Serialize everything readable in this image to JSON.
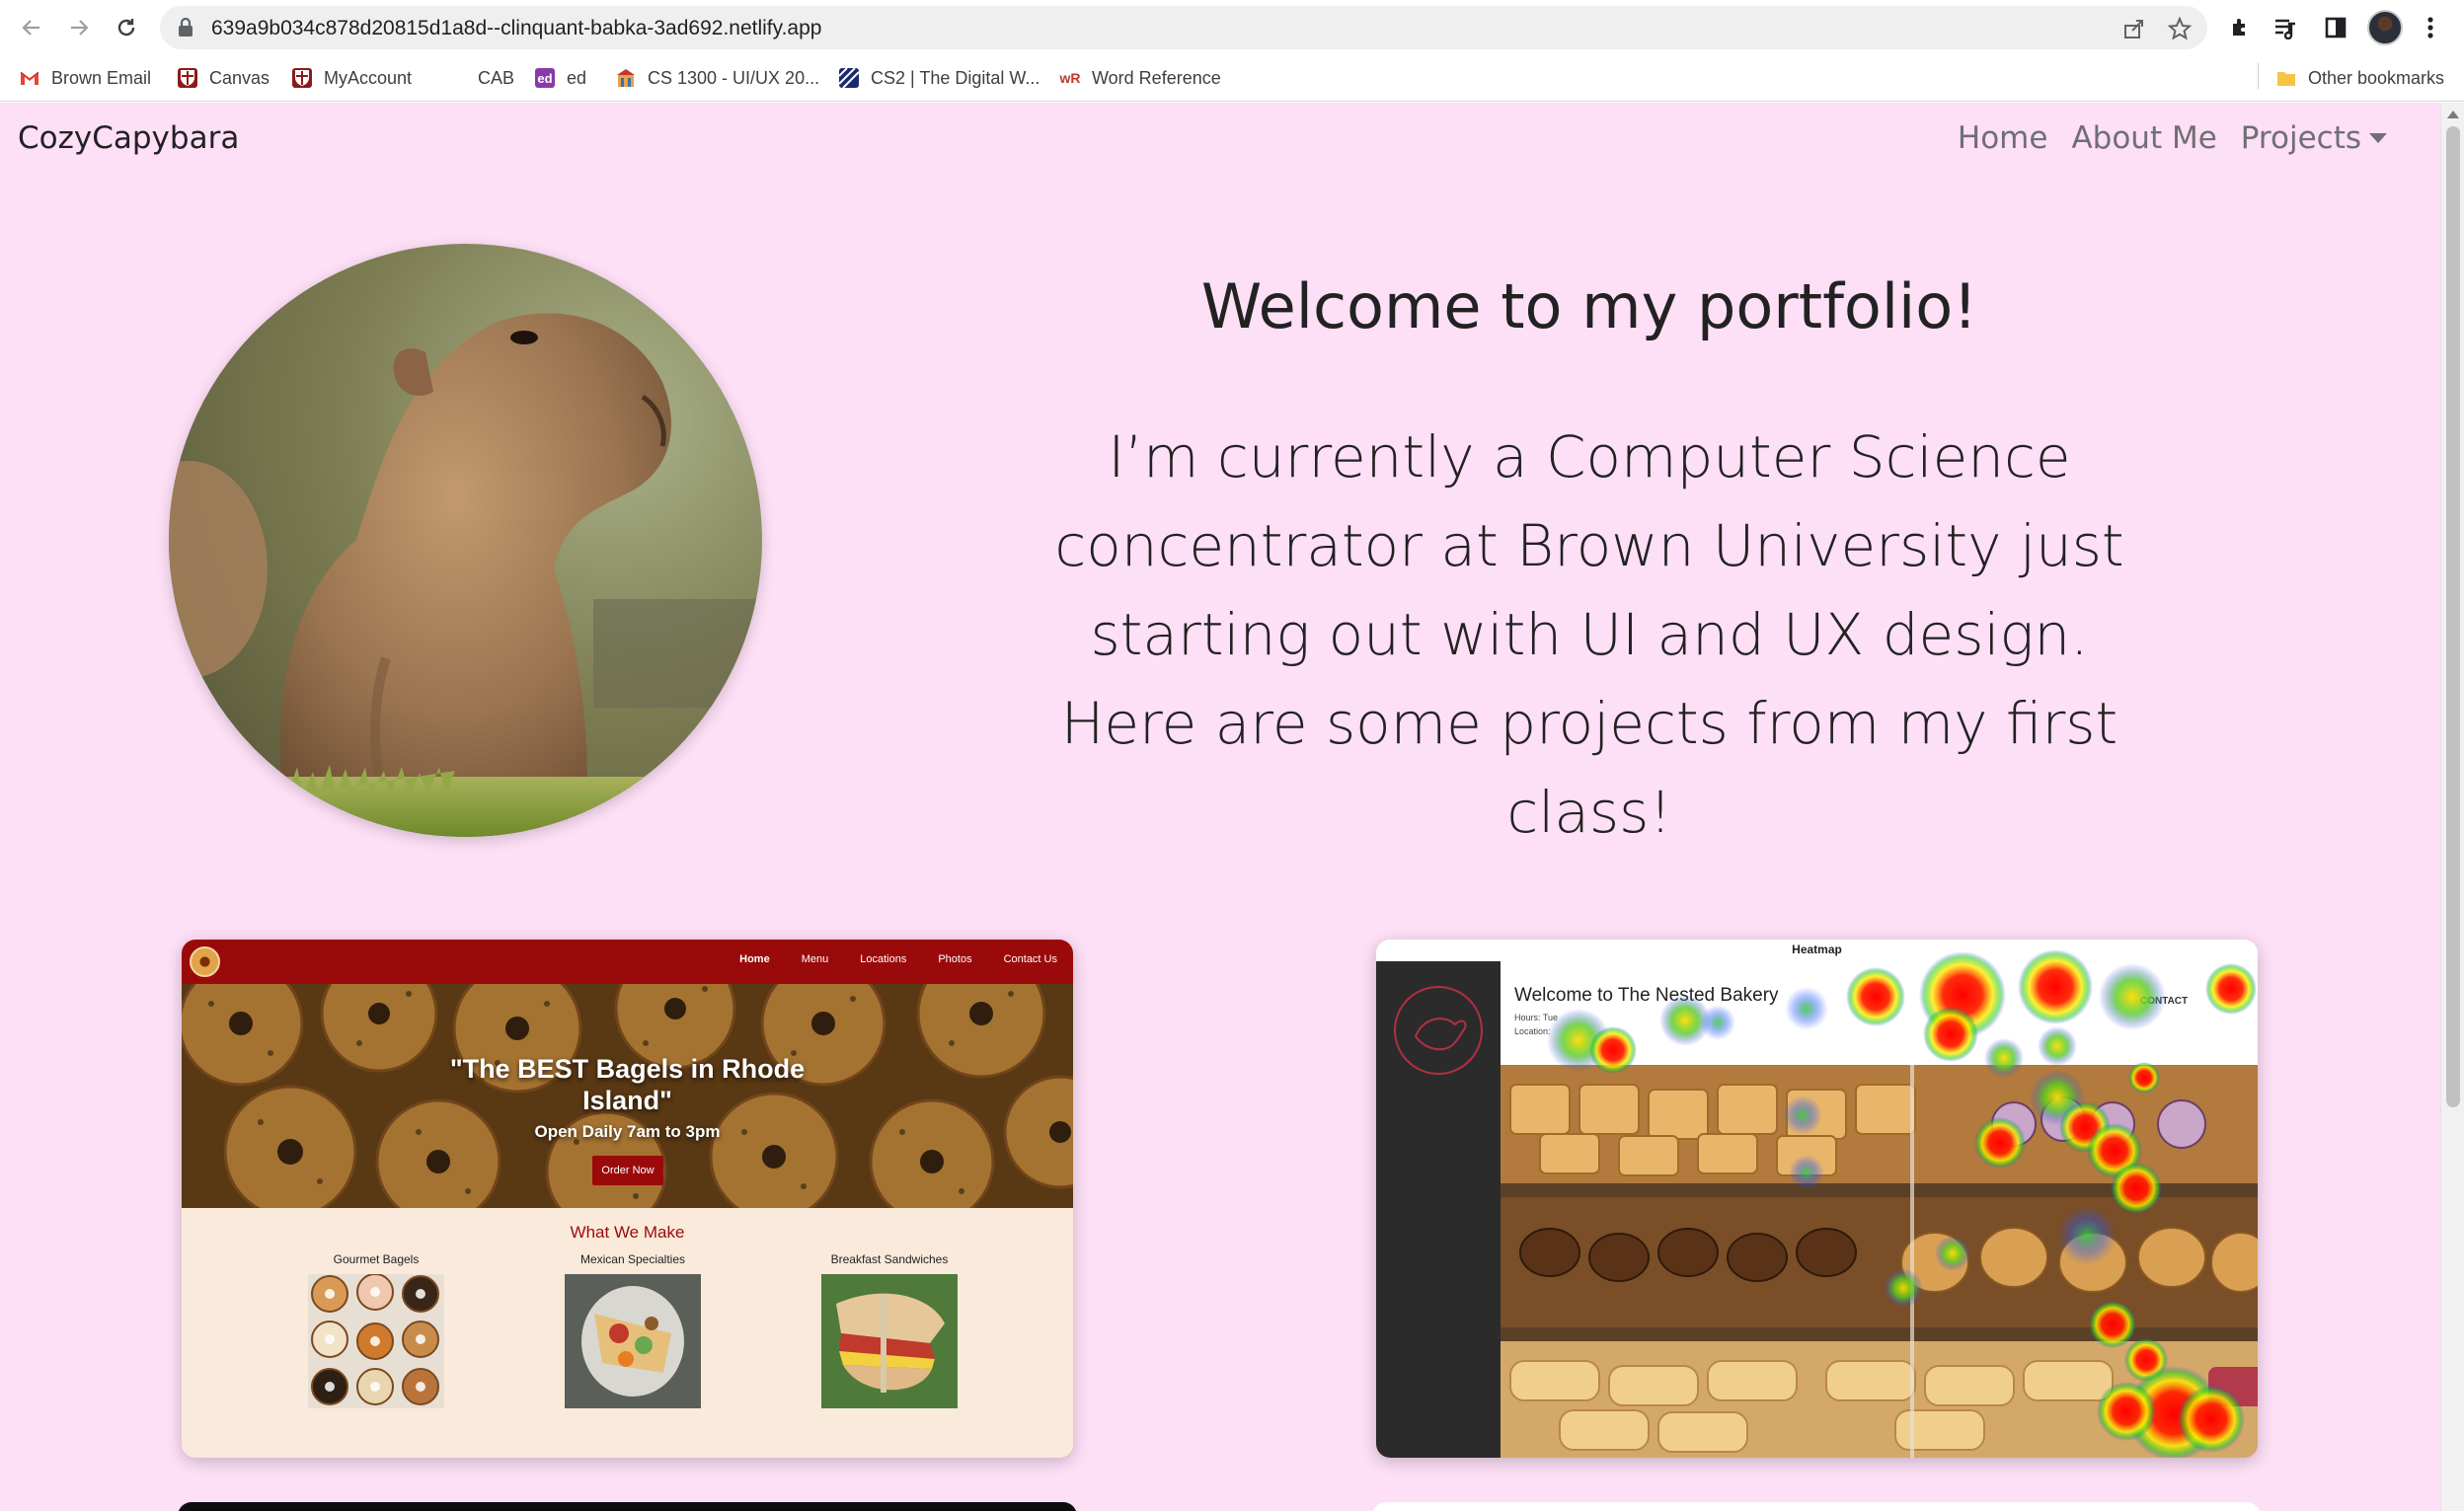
{
  "browser": {
    "url": "639a9b034c878d20815d1a8d--clinquant-babka-3ad692.netlify.app",
    "bookmarks": [
      {
        "label": "Brown Email",
        "icon": "gmail-icon"
      },
      {
        "label": "Canvas",
        "icon": "shield-icon"
      },
      {
        "label": "MyAccount",
        "icon": "shield-icon"
      },
      {
        "label": "CAB",
        "icon": "blank-icon"
      },
      {
        "label": "ed",
        "icon": "ed-icon"
      },
      {
        "label": "CS 1300 - UI/UX 20...",
        "icon": "building-icon"
      },
      {
        "label": "CS2 | The Digital W...",
        "icon": "stripes-icon"
      },
      {
        "label": "Word Reference",
        "icon": "wr-icon"
      }
    ],
    "other_bookmarks": "Other bookmarks"
  },
  "site": {
    "brand": "CozyCapybara",
    "nav": {
      "home": "Home",
      "about": "About Me",
      "projects": "Projects"
    },
    "hero": {
      "heading": "Welcome to my portfolio!",
      "body": "I’m currently a Computer Science concentrator at Brown University just starting out with UI and UX design. Here are some projects from my first class!"
    },
    "colors": {
      "page_bg": "#fddff6",
      "text": "#222222",
      "nav_text": "#6f6f73"
    }
  },
  "projects": {
    "bagel": {
      "nav": [
        "Home",
        "Menu",
        "Locations",
        "Photos",
        "Contact Us"
      ],
      "headline": "\"The BEST Bagels in Rhode Island\"",
      "hours": "Open Daily 7am to 3pm",
      "cta": "Order Now",
      "section_title": "What We Make",
      "items": [
        "Gourmet Bagels",
        "Mexican Specialties",
        "Breakfast Sandwiches"
      ],
      "accent": "#9b0a0a"
    },
    "heatmap": {
      "label": "Heatmap",
      "title": "Welcome to The Nested Bakery",
      "hours": "Hours: Tue",
      "location": "Location:",
      "contact": "CONTACT"
    }
  }
}
